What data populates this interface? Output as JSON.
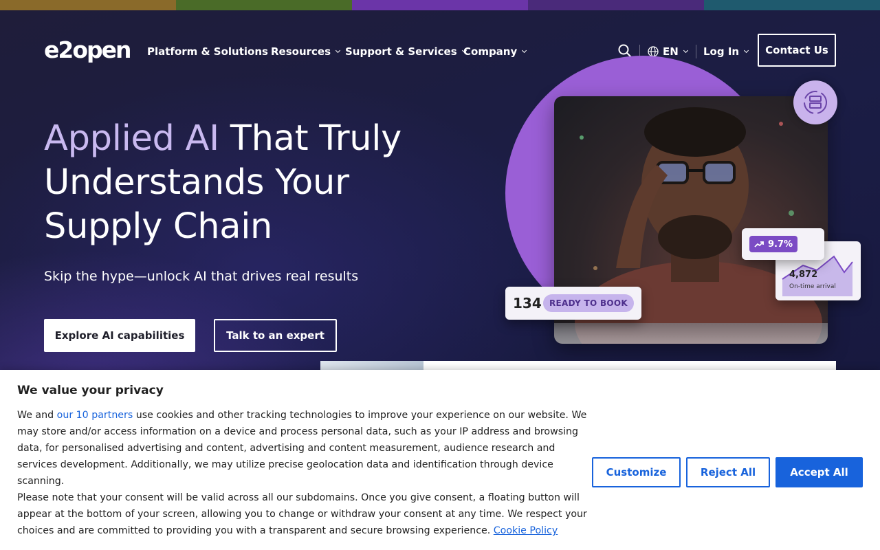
{
  "colors": {
    "topbar": [
      "#8a6a2a",
      "#4a6b28",
      "#6b35a8",
      "#4a2a7a",
      "#1f5a6e"
    ],
    "accent_headline": "#c9b9f0",
    "hero_circle": "#9a5fd6",
    "cookie_blue": "#1863dc"
  },
  "nav": {
    "logo": "e2open",
    "items": [
      {
        "label": "Platform & Solutions"
      },
      {
        "label": "Resources"
      },
      {
        "label": "Support & Services"
      },
      {
        "label": "Company"
      }
    ],
    "language": "EN",
    "login": "Log In",
    "contact": "Contact Us",
    "icons": [
      "search-icon",
      "globe-icon",
      "chevron-down-icon"
    ]
  },
  "hero": {
    "headline_accent": "Applied AI",
    "headline_rest": " That Truly Understands Your Supply Chain",
    "subline": "Skip the hype—unlock AI that drives real results",
    "primary_cta": "Explore AI capabilities",
    "secondary_cta": "Talk to an expert",
    "stat_pct": "9.7%",
    "stat_number": "4,872",
    "stat_label": "On-time arrival",
    "book_number": "134",
    "book_label": "READY TO BOOK"
  },
  "cookie": {
    "title": "We value your privacy",
    "p1_before": "We and ",
    "p1_link": "our 10 partners",
    "p1_after": " use cookies and other tracking technologies to improve your experience on our website. We may store and/or access information on a device and process personal data, such as your IP address and browsing data, for personalised advertising and content, advertising and content measurement, audience research and services development. Additionally, we may utilize precise geolocation data and identification through device scanning.",
    "p2": "Please note that your consent will be valid across all our subdomains. Once you give consent, a floating button will appear at the bottom of your screen, allowing you to change or withdraw your consent at any time. We respect your choices and are committed to providing you with a transparent and secure browsing experience. ",
    "p2_link": "Cookie Policy",
    "customize": "Customize",
    "reject": "Reject All",
    "accept": "Accept All"
  }
}
